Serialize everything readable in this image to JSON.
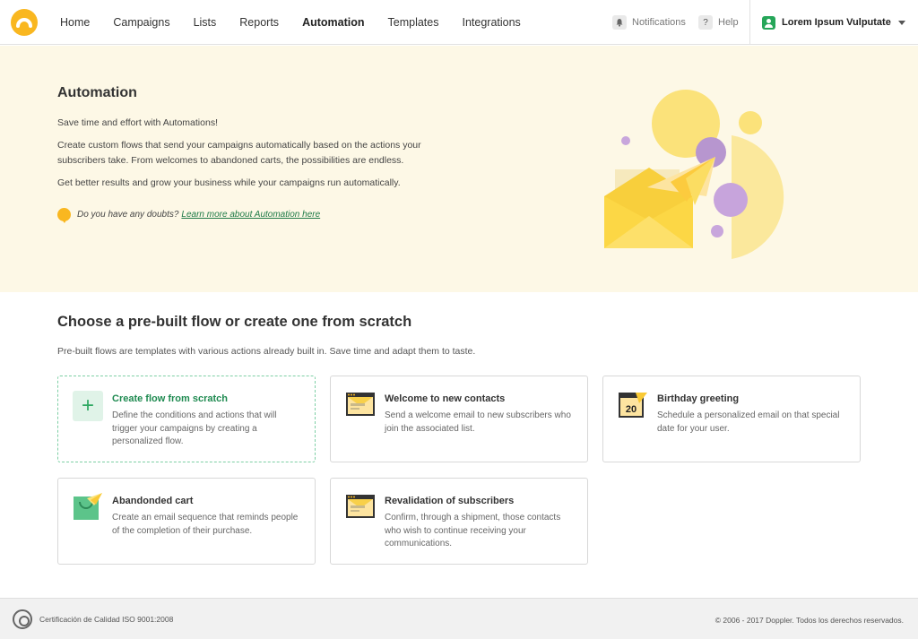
{
  "header": {
    "nav": [
      {
        "label": "Home",
        "active": false
      },
      {
        "label": "Campaigns",
        "active": false
      },
      {
        "label": "Lists",
        "active": false
      },
      {
        "label": "Reports",
        "active": false
      },
      {
        "label": "Automation",
        "active": true
      },
      {
        "label": "Templates",
        "active": false
      },
      {
        "label": "Integrations",
        "active": false
      }
    ],
    "notifications_label": "Notifications",
    "help_label": "Help",
    "help_icon": "?",
    "user_name": "Lorem Ipsum Vulputate"
  },
  "hero": {
    "title": "Automation",
    "p1": "Save time and effort with Automations!",
    "p2": "Create custom flows that send your campaigns automatically based on the actions your subscribers take. From welcomes to abandoned carts, the possibilities are endless.",
    "p3": "Get better results and grow your business while your campaigns run automatically.",
    "doubt_text": "Do you have any doubts?",
    "doubt_link": "Learn more about Automation here"
  },
  "section": {
    "title": "Choose a pre-built flow or create one from scratch",
    "subtitle": "Pre-built flows are templates with various actions already built in. Save time and adapt them to taste."
  },
  "cards": [
    {
      "title": "Create flow from scratch",
      "description": "Define the conditions and actions that will trigger your campaigns by creating a personalized flow.",
      "icon": "plus-icon"
    },
    {
      "title": "Welcome to new contacts",
      "description": "Send a welcome email to new subscribers who join the associated list.",
      "icon": "welcome-email-icon"
    },
    {
      "title": "Birthday greeting",
      "description": "Schedule a personalized email on that special date for your user.",
      "icon": "calendar-icon",
      "icon_text": "20"
    },
    {
      "title": "Abandonded cart",
      "description": "Create an email sequence that reminds people of the completion of their purchase.",
      "icon": "shopping-bag-icon"
    },
    {
      "title": "Revalidation of subscribers",
      "description": "Confirm, through a shipment, those contacts who wish to continue receiving your communications.",
      "icon": "revalidation-email-icon"
    }
  ],
  "footer": {
    "cert": "Certificación de Calidad ISO 9001:2008",
    "copyright": "© 2006 - 2017 Doppler. Todos los derechos reservados."
  },
  "colors": {
    "brand_yellow": "#f9b720",
    "hero_bg": "#fdf8e6",
    "accent_green": "#1e8a50",
    "purple": "#b796cf"
  }
}
